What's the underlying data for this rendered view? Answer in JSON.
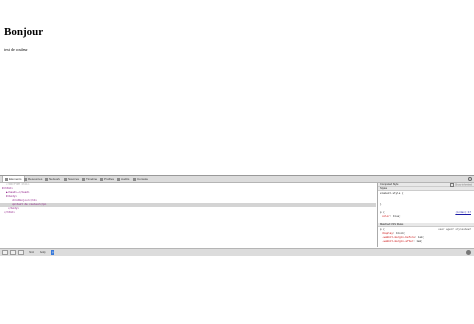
{
  "page": {
    "heading": "Bonjour",
    "paragraph": "text de couleur"
  },
  "devtools": {
    "tabs": [
      "Elements",
      "Resources",
      "Network",
      "Sources",
      "Timeline",
      "Profiles",
      "Audits",
      "Console"
    ],
    "elements_lines": [
      {
        "text": "<!DOCTYPE html>",
        "kind": "comment"
      },
      {
        "text": "▼<html>",
        "kind": "tag"
      },
      {
        "text": "▶<head>…</head>",
        "kind": "tag"
      },
      {
        "text": "▼<body>",
        "kind": "tag"
      },
      {
        "text": "<h1>Bonjour</h1>",
        "kind": "tag"
      },
      {
        "text": "<p>text de couleur</p>",
        "kind": "tag"
      },
      {
        "text": "</body>",
        "kind": "tag"
      },
      {
        "text": "</html>",
        "kind": "tag"
      }
    ],
    "sidebar": {
      "computed_style_label": "Computed Style",
      "show_inherited_label": "Show inherited",
      "styles_label": "Styles",
      "element_style": "element.style {",
      "element_style_close": "}",
      "rule_selector": "p {",
      "rule_prop": "color",
      "rule_value": "blue;",
      "rule_source": "(index):17",
      "matched_label": "Matched CSS Rules",
      "ua_selector": "p {",
      "ua_source": "user agent stylesheet",
      "ua_props": [
        {
          "prop": "display",
          "value": "block;"
        },
        {
          "prop": "-webkit-margin-before",
          "value": "1em;"
        },
        {
          "prop": "-webkit-margin-after",
          "value": "1em;"
        }
      ]
    },
    "breadcrumbs": [
      "html",
      "body",
      "p"
    ]
  }
}
